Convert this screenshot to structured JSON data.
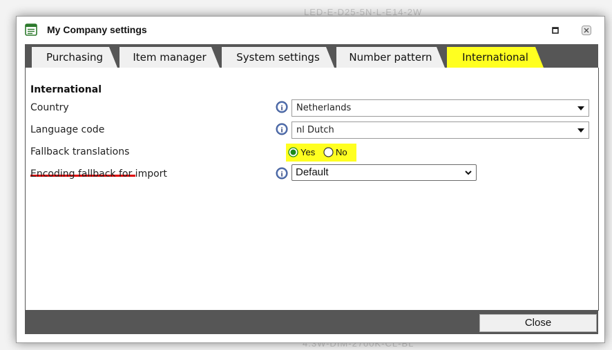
{
  "background": {
    "top_text": "LED-E-D25-5N-L-E14-2W",
    "bottom_text": "4.3W-DIM-2700K-CL-BL"
  },
  "window": {
    "title": "My Company settings",
    "icon": "settings-form-icon",
    "controls": {
      "maximize_icon": "maximize-icon",
      "close_icon": "close-icon"
    }
  },
  "tabs": [
    {
      "label": "Purchasing",
      "active": false
    },
    {
      "label": "Item manager",
      "active": false
    },
    {
      "label": "System settings",
      "active": false
    },
    {
      "label": "Number pattern",
      "active": false
    },
    {
      "label": "International",
      "active": true
    }
  ],
  "section": {
    "title": "International",
    "rows": [
      {
        "label": "Country",
        "value": "Netherlands",
        "control": "dropdown"
      },
      {
        "label": "Language code",
        "value": "nl Dutch",
        "control": "dropdown"
      },
      {
        "label": "Fallback translations",
        "control": "radio",
        "options": [
          {
            "label": "Yes",
            "checked": true
          },
          {
            "label": "No",
            "checked": false
          }
        ]
      },
      {
        "label": "Encoding fallback for import",
        "value": "Default",
        "control": "select"
      }
    ]
  },
  "footer": {
    "close_label": "Close"
  },
  "colors": {
    "highlight": "#ffff20",
    "tabstrip": "#565656",
    "underline": "#e00000",
    "radio_checked": "#1a8a1a"
  }
}
